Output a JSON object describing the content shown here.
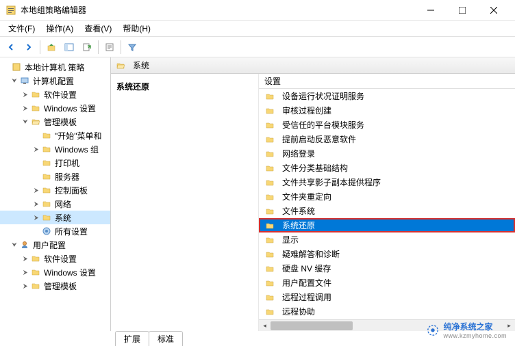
{
  "window": {
    "title": "本地组策略编辑器"
  },
  "menu": {
    "file": "文件(F)",
    "action": "操作(A)",
    "view": "查看(V)",
    "help": "帮助(H)"
  },
  "tree": {
    "root": "本地计算机 策略",
    "computer_config": "计算机配置",
    "software_settings": "软件设置",
    "windows_settings": "Windows 设置",
    "admin_templates": "管理模板",
    "start_menu": "\"开始\"菜单和",
    "windows_comp": "Windows 组",
    "printer": "打印机",
    "server": "服务器",
    "control_panel": "控制面板",
    "network": "网络",
    "system": "系统",
    "all_settings": "所有设置",
    "user_config": "用户配置",
    "user_software": "软件设置",
    "user_windows": "Windows 设置",
    "user_admin": "管理模板"
  },
  "content": {
    "header": "系统",
    "title": "系统还原",
    "column_header": "设置"
  },
  "items": [
    "设备运行状况证明服务",
    "审核过程创建",
    "受信任的平台模块服务",
    "提前启动反恶意软件",
    "网络登录",
    "文件分类基础结构",
    "文件共享影子副本提供程序",
    "文件夹重定向",
    "文件系统",
    "系统还原",
    "显示",
    "疑难解答和诊断",
    "硬盘 NV 缓存",
    "用户配置文件",
    "远程过程调用",
    "远程协助"
  ],
  "tabs": {
    "extended": "扩展",
    "standard": "标准"
  },
  "watermark": {
    "text": "纯净系统之家",
    "url": "www.kzmyhome.com"
  }
}
